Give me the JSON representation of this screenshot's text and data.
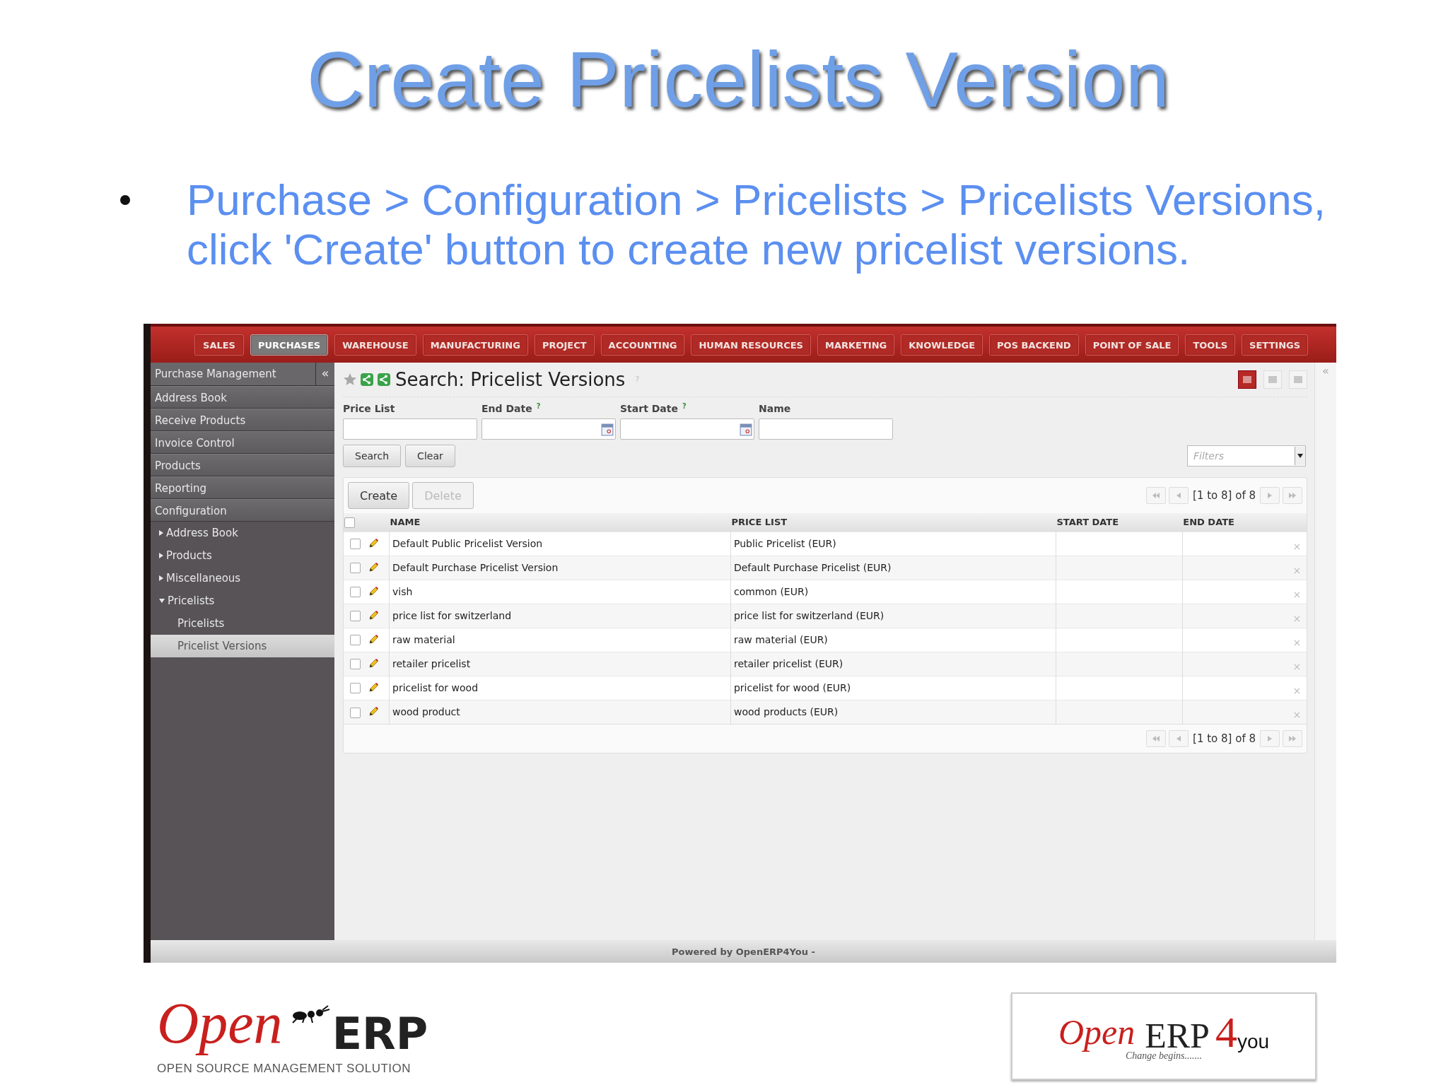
{
  "slide": {
    "title": "Create Pricelists Version",
    "bullets": [
      "Purchase > Configuration > Pricelists > Pricelists Versions, click 'Create' button to create new pricelist versions."
    ]
  },
  "app": {
    "menu": [
      {
        "label": "SALES",
        "selected": false
      },
      {
        "label": "PURCHASES",
        "selected": true
      },
      {
        "label": "WAREHOUSE",
        "selected": false
      },
      {
        "label": "MANUFACTURING",
        "selected": false
      },
      {
        "label": "PROJECT",
        "selected": false
      },
      {
        "label": "ACCOUNTING",
        "selected": false
      },
      {
        "label": "HUMAN RESOURCES",
        "selected": false
      },
      {
        "label": "MARKETING",
        "selected": false
      },
      {
        "label": "KNOWLEDGE",
        "selected": false
      },
      {
        "label": "POS BACKEND",
        "selected": false
      },
      {
        "label": "POINT OF SALE",
        "selected": false
      },
      {
        "label": "TOOLS",
        "selected": false
      },
      {
        "label": "SETTINGS",
        "selected": false
      }
    ],
    "sidebar": {
      "title": "Purchase Management",
      "collapse": "«",
      "items": [
        {
          "label": "Address Book",
          "selected": false
        },
        {
          "label": "Receive Products",
          "selected": false
        },
        {
          "label": "Invoice Control",
          "selected": false
        },
        {
          "label": "Products",
          "selected": false
        },
        {
          "label": "Reporting",
          "selected": false
        },
        {
          "label": "Configuration",
          "selected": false,
          "children": [
            {
              "label": "Address Book",
              "expanded": false,
              "selected": false
            },
            {
              "label": "Products",
              "expanded": false,
              "selected": false
            },
            {
              "label": "Miscellaneous",
              "expanded": false,
              "selected": false
            },
            {
              "label": "Pricelists",
              "expanded": true,
              "selected": false,
              "children": [
                {
                  "label": "Pricelists",
                  "selected": false
                },
                {
                  "label": "Pricelist Versions",
                  "selected": true
                }
              ]
            }
          ]
        }
      ]
    },
    "header": {
      "title": "Search: Pricelist Versions",
      "help": "?",
      "views": [
        {
          "selected": true
        },
        {
          "selected": false
        },
        {
          "selected": false
        }
      ],
      "collapse": "«"
    },
    "search_fields": [
      {
        "label": "Price List",
        "help": false,
        "kind": "text"
      },
      {
        "label": "End Date",
        "help": true,
        "kind": "date"
      },
      {
        "label": "Start Date",
        "help": true,
        "kind": "date"
      },
      {
        "label": "Name",
        "help": false,
        "kind": "text"
      }
    ],
    "help_mark": "?",
    "search_buttons": [
      "Search",
      "Clear"
    ],
    "filters": {
      "placeholder": "Filters"
    },
    "list_buttons": [
      {
        "label": "Create",
        "disabled": false
      },
      {
        "label": "Delete",
        "disabled": true
      }
    ],
    "pager_top": "[1 to 8] of 8",
    "pager_bottom": "[1 to 8] of 8",
    "select_all_checked": false,
    "columns": [
      "NAME",
      "PRICE LIST",
      "START DATE",
      "END DATE"
    ],
    "rows": [
      {
        "name": "Default Public Pricelist Version",
        "pricelist": "Public Pricelist (EUR)",
        "checked": false
      },
      {
        "name": "Default Purchase Pricelist Version",
        "pricelist": "Default Purchase Pricelist (EUR)",
        "checked": false
      },
      {
        "name": "vish",
        "pricelist": "common (EUR)",
        "checked": false
      },
      {
        "name": "price list for switzerland",
        "pricelist": "price list for switzerland (EUR)",
        "checked": false
      },
      {
        "name": "raw material",
        "pricelist": "raw material (EUR)",
        "checked": false
      },
      {
        "name": "retailer pricelist",
        "pricelist": "retailer pricelist (EUR)",
        "checked": false
      },
      {
        "name": "pricelist for wood",
        "pricelist": "pricelist for wood (EUR)",
        "checked": false
      },
      {
        "name": "wood product",
        "pricelist": "wood products (EUR)",
        "checked": false
      }
    ],
    "delete_mark": "×",
    "footer": "Powered by OpenERP4You -"
  },
  "logos": {
    "left": {
      "word_1": "Open",
      "word_2": "ERP",
      "tagline": "OPEN SOURCE MANAGEMENT SOLUTION"
    },
    "right": {
      "word_1": "Open",
      "word_2": "ERP",
      "number": "4",
      "suffix": "you",
      "tagline": "Change begins......."
    }
  }
}
